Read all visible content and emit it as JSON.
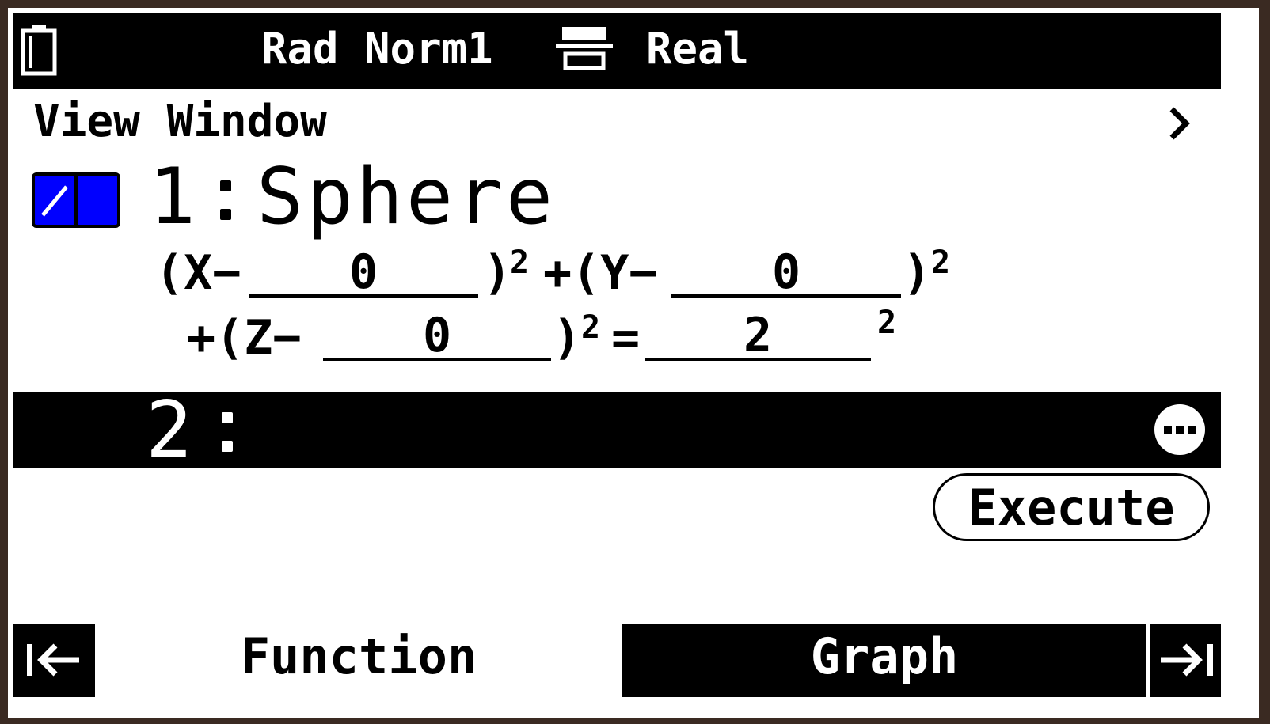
{
  "status_bar": {
    "battery_icon": "battery-icon",
    "mode": "Rad Norm1",
    "display_icon": "display-format-icon",
    "number_format": "Real"
  },
  "header": {
    "title": "View Window",
    "chevron_icon": "chevron-right-icon"
  },
  "functions": [
    {
      "index": "1",
      "type": "Sphere",
      "enabled": true,
      "toggle_color": "#0000ff",
      "equation": {
        "x_prefix": "(X−",
        "x_value": "0",
        "x_suffix": ")",
        "plus_y_prefix": "+(Y−",
        "y_value": "0",
        "y_suffix": ")",
        "plus_z_prefix": "+(Z−",
        "z_value": "0",
        "z_suffix": ")",
        "equals": "=",
        "r_value": "2",
        "exponent": "2"
      }
    },
    {
      "index": "2",
      "more_icon": "more-options-icon"
    }
  ],
  "execute_label": "Execute",
  "bottom_bar": {
    "nav_left_icon": "arrow-to-start-icon",
    "tab_function": "Function",
    "tab_graph": "Graph",
    "nav_right_icon": "arrow-to-end-icon"
  }
}
